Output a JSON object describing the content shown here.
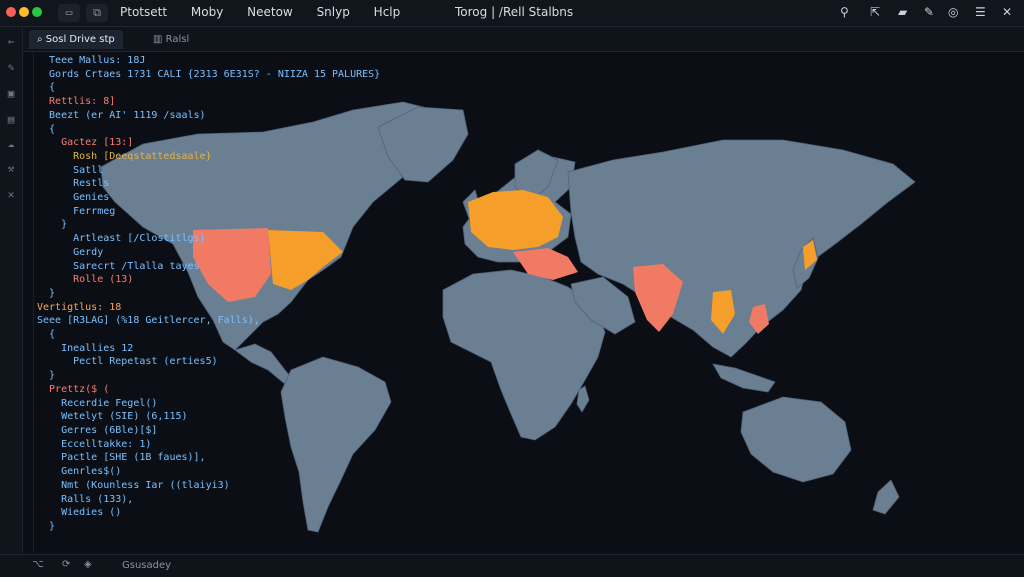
{
  "titlebar": {
    "menu": [
      "Ptotsett",
      "Moby",
      "Neetow",
      "Snlyp",
      "Hclp"
    ],
    "title": "Torog | /Rell Stalbns"
  },
  "tabs": {
    "active": "Sosl Drive stp",
    "inactive": "Ralsl"
  },
  "code": [
    {
      "text": "Teee Mallus: 18J",
      "c": "k",
      "i": 1
    },
    {
      "text": "Gords Crtaes 1?31 CALI {2313 6E31S? - NIIZA 15 PALURES}",
      "c": "k",
      "i": 1
    },
    {
      "text": "{",
      "c": "k",
      "i": 1
    },
    {
      "text": "Rettlis: 8]",
      "c": "r",
      "i": 1
    },
    {
      "text": "Beezt (er AI' 1119 /saals)",
      "c": "k",
      "i": 1
    },
    {
      "text": "{",
      "c": "k",
      "i": 1
    },
    {
      "text": "Gactez [13:]",
      "c": "r",
      "i": 2
    },
    {
      "text": "Rosh [Deeqstattedsaale}",
      "c": "y",
      "i": 3
    },
    {
      "text": "Satll",
      "c": "k",
      "i": 3
    },
    {
      "text": "Restls",
      "c": "k",
      "i": 3
    },
    {
      "text": "Genies",
      "c": "k",
      "i": 3
    },
    {
      "text": "Ferrmeg",
      "c": "k",
      "i": 3
    },
    {
      "text": "}",
      "c": "k",
      "i": 2
    },
    {
      "text": "Artleast [/Clostitlgs}",
      "c": "k",
      "i": 3
    },
    {
      "text": "Gerdy",
      "c": "k",
      "i": 3
    },
    {
      "text": "Sarecrt /Tlalla tayes",
      "c": "k",
      "i": 3
    },
    {
      "text": "Rolle (13)",
      "c": "r",
      "i": 3
    },
    {
      "text": "}",
      "c": "k",
      "i": 1
    },
    {
      "text": "Vertigtlus: 18",
      "c": "s",
      "i": 0
    },
    {
      "text": "Seee [R3LAG] (%18 Geitlercer, Falls),",
      "c": "k",
      "i": 0
    },
    {
      "text": "{",
      "c": "k",
      "i": 1
    },
    {
      "text": "Ineallies 12",
      "c": "k",
      "i": 2
    },
    {
      "text": "Pectl Repetast (erties5)",
      "c": "k",
      "i": 3
    },
    {
      "text": "}",
      "c": "k",
      "i": 1
    },
    {
      "text": "",
      "c": "k",
      "i": 0
    },
    {
      "text": "Prettz($ (",
      "c": "r",
      "i": 1
    },
    {
      "text": "Recerdie Fegel()",
      "c": "k",
      "i": 2
    },
    {
      "text": "Wetelyt (SIE) (6,115)",
      "c": "k",
      "i": 2
    },
    {
      "text": "Gerres (6Ble)[$]",
      "c": "k",
      "i": 2
    },
    {
      "text": "Eccelltakke: 1)",
      "c": "k",
      "i": 2
    },
    {
      "text": "Pactle [SHE (1B faues)],",
      "c": "k",
      "i": 2
    },
    {
      "text": "Genrles$()",
      "c": "k",
      "i": 2
    },
    {
      "text": "Nmt (Kounless Iar ((tlaiyi3)",
      "c": "k",
      "i": 2
    },
    {
      "text": "Ralls (133),",
      "c": "k",
      "i": 2
    },
    {
      "text": "Wiedies ()",
      "c": "k",
      "i": 2
    },
    {
      "text": "}",
      "c": "k",
      "i": 1
    }
  ],
  "status": {
    "label": "Gsusadey"
  },
  "icons": {
    "back": "back-arrow-icon",
    "search": "search-icon",
    "files": "files-icon"
  },
  "colors": {
    "background": "#0b0f15",
    "land": "#6b7f92",
    "highlight_red": "#f07a63",
    "highlight_orange": "#f59e2a"
  }
}
